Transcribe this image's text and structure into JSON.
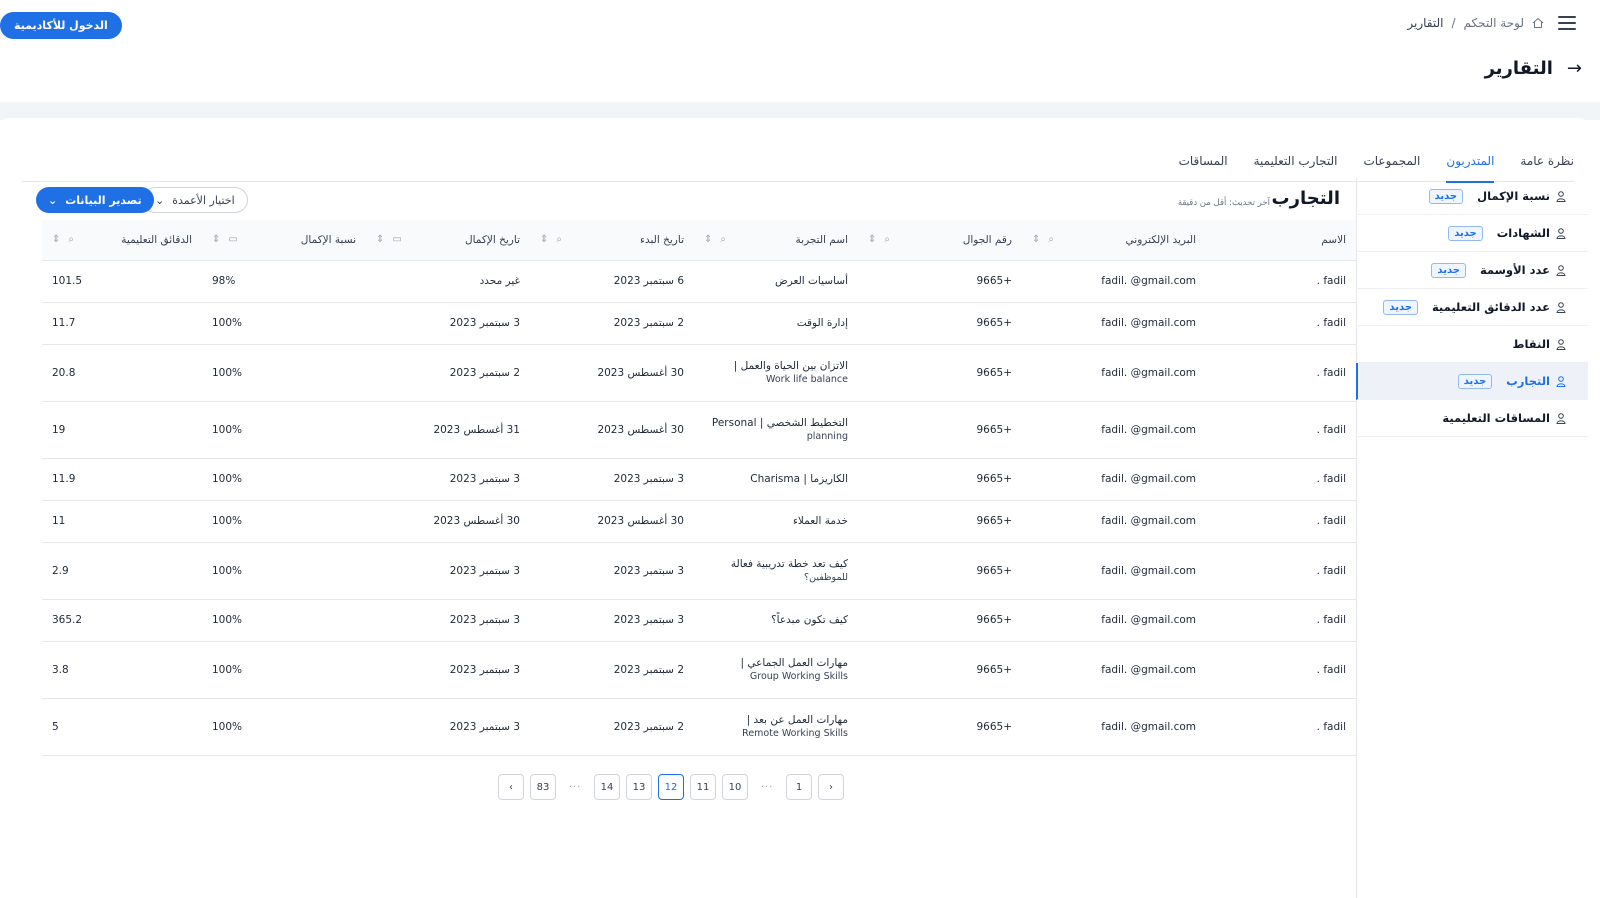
{
  "header": {
    "breadcrumb": [
      "لوحة التحكم",
      "/",
      "التقارير"
    ],
    "academy_button": "الدخول للأكاديمية",
    "page_title": "التقارير"
  },
  "tabs": [
    {
      "label": "نظرة عامة",
      "active": false
    },
    {
      "label": "المتدربون",
      "active": true
    },
    {
      "label": "المجموعات",
      "active": false
    },
    {
      "label": "التجارب التعليمية",
      "active": false
    },
    {
      "label": "المساقات",
      "active": false
    }
  ],
  "sidebar": {
    "badge": "جديد",
    "items": [
      {
        "label": "نسبة الإكمال",
        "new": true,
        "active": false
      },
      {
        "label": "الشهادات",
        "new": true,
        "active": false
      },
      {
        "label": "عدد الأوسمة",
        "new": true,
        "active": false
      },
      {
        "label": "عدد الدقائق التعليمية",
        "new": true,
        "active": false
      },
      {
        "label": "النقاط",
        "new": false,
        "active": false
      },
      {
        "label": "التجارب",
        "new": true,
        "active": true
      },
      {
        "label": "المساقات التعليمية",
        "new": false,
        "active": false
      }
    ]
  },
  "panel": {
    "title": "التجارب",
    "subtitle": "آخر تحديث: أقل من دقيقة",
    "export_button": "تصدير البيانات",
    "columns_button": "اختيار الأعمدة"
  },
  "table": {
    "headers": [
      "الاسم",
      "البريد الإلكتروني",
      "رقم الجوال",
      "اسم التجربة",
      "تاريخ البدء",
      "تاريخ الإكمال",
      "نسبة الإكمال",
      "الدقائق التعليمية"
    ],
    "rows": [
      {
        "name": "fadil .",
        "email": "fadil.  ‎@gmail.com",
        "phone": "+9665",
        "exp": "أساسيات العرض",
        "exp_sub": "",
        "start": "6 سبتمبر 2023",
        "end": "غير محدد",
        "pct": "98%",
        "mins": "101.5"
      },
      {
        "name": "fadil .",
        "email": "fadil.  ‎@gmail.com",
        "phone": "+9665",
        "exp": "إدارة الوقت",
        "exp_sub": "",
        "start": "2 سبتمبر 2023",
        "end": "3 سبتمبر 2023",
        "pct": "100%",
        "mins": "11.7"
      },
      {
        "name": "fadil .",
        "email": "fadil.  ‎@gmail.com",
        "phone": "+9665",
        "exp": "الاتزان بين الحياة والعمل |",
        "exp_sub": "Work life balance",
        "start": "30 أغسطس 2023",
        "end": "2 سبتمبر 2023",
        "pct": "100%",
        "mins": "20.8"
      },
      {
        "name": "fadil .",
        "email": "fadil.  ‎@gmail.com",
        "phone": "+9665",
        "exp": "التخطيط الشخصي | Personal",
        "exp_sub": "planning",
        "start": "30 أغسطس 2023",
        "end": "31 أغسطس 2023",
        "pct": "100%",
        "mins": "19"
      },
      {
        "name": "fadil .",
        "email": "fadil.  ‎@gmail.com",
        "phone": "+9665",
        "exp": "الكاريزما | Charisma",
        "exp_sub": "",
        "start": "3 سبتمبر 2023",
        "end": "3 سبتمبر 2023",
        "pct": "100%",
        "mins": "11.9"
      },
      {
        "name": "fadil .",
        "email": "fadil.  ‎@gmail.com",
        "phone": "+9665",
        "exp": "خدمة العملاء",
        "exp_sub": "",
        "start": "30 أغسطس 2023",
        "end": "30 أغسطس 2023",
        "pct": "100%",
        "mins": "11"
      },
      {
        "name": "fadil .",
        "email": "fadil.  ‎@gmail.com",
        "phone": "+9665",
        "exp": "كيف تعد خطة تدريبية فعالة",
        "exp_sub": "للموظفين؟",
        "start": "3 سبتمبر 2023",
        "end": "3 سبتمبر 2023",
        "pct": "100%",
        "mins": "2.9"
      },
      {
        "name": "fadil .",
        "email": "fadil.  ‎@gmail.com",
        "phone": "+9665",
        "exp": "كيف تكون مبدعاً؟",
        "exp_sub": "",
        "start": "3 سبتمبر 2023",
        "end": "3 سبتمبر 2023",
        "pct": "100%",
        "mins": "365.2"
      },
      {
        "name": "fadil .",
        "email": "fadil.  ‎@gmail.com",
        "phone": "+9665",
        "exp": "مهارات العمل الجماعي |",
        "exp_sub": "Group Working Skills",
        "start": "2 سبتمبر 2023",
        "end": "3 سبتمبر 2023",
        "pct": "100%",
        "mins": "3.8"
      },
      {
        "name": "fadil .",
        "email": "fadil.  ‎@gmail.com",
        "phone": "+9665",
        "exp": "مهارات العمل عن بعد |",
        "exp_sub": "Remote Working Skills",
        "start": "2 سبتمبر 2023",
        "end": "3 سبتمبر 2023",
        "pct": "100%",
        "mins": "5"
      }
    ]
  },
  "pagination": {
    "prev": "‹",
    "next": "›",
    "pages": [
      "1",
      "···",
      "10",
      "11",
      "12",
      "13",
      "14",
      "···",
      "83"
    ],
    "current": "12"
  }
}
